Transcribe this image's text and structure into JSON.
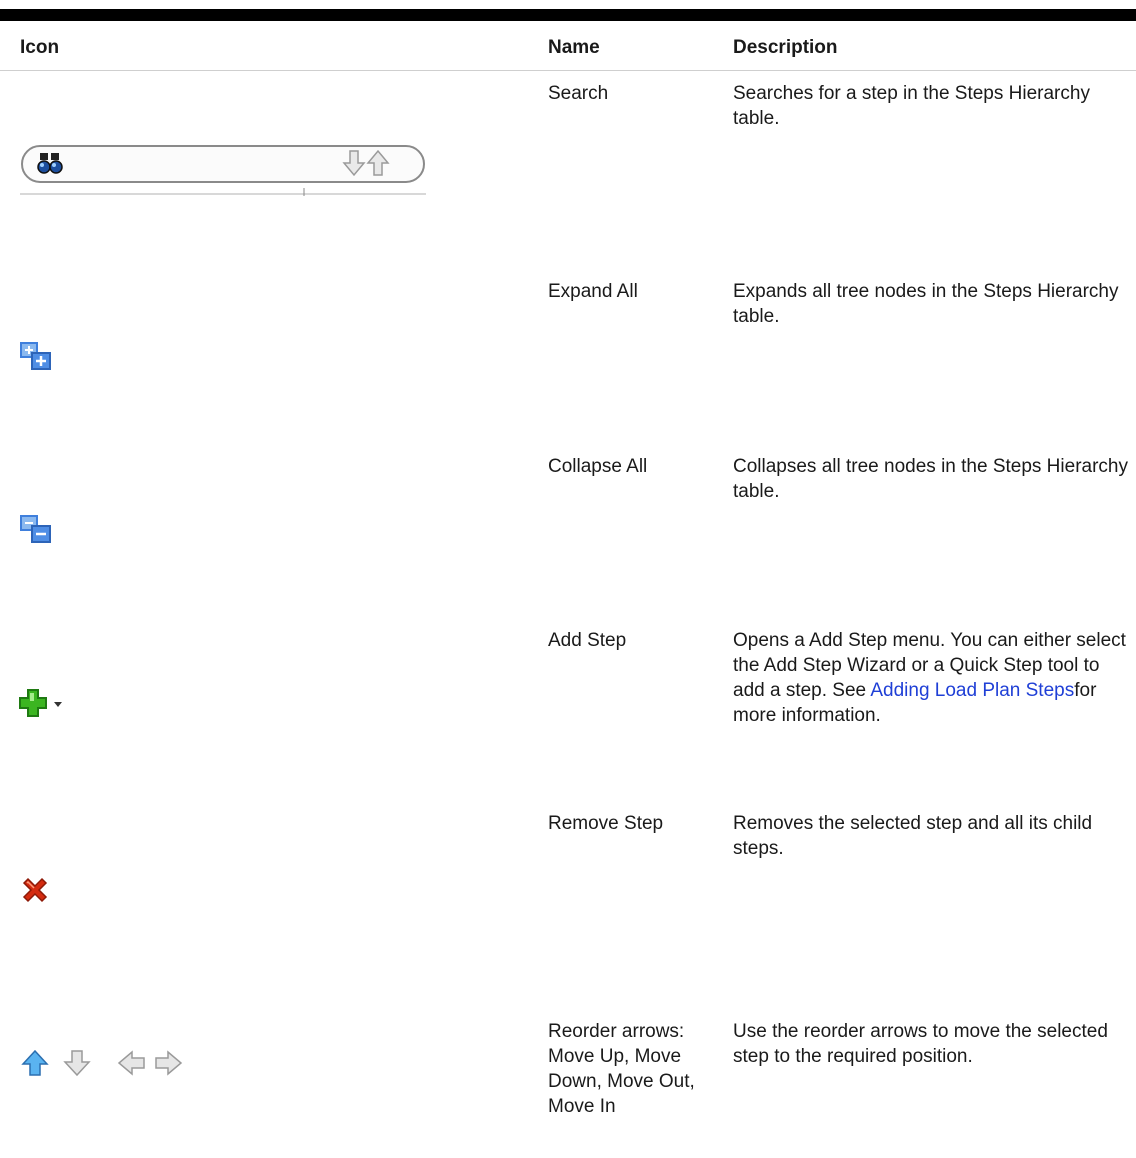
{
  "header": {
    "icon": "Icon",
    "name": "Name",
    "description": "Description"
  },
  "rows": [
    {
      "icon": "search-field-icon",
      "name": "Search",
      "description": "Searches for a step in the Steps Hierarchy table."
    },
    {
      "icon": "expand-all-icon",
      "name": "Expand All",
      "description": "Expands all tree nodes in the Steps Hierarchy table."
    },
    {
      "icon": "collapse-all-icon",
      "name": "Collapse All",
      "description": "Collapses all tree nodes in the Steps Hierarchy table."
    },
    {
      "icon": "add-step-icon",
      "name": "Add Step",
      "description_pre": "Opens a Add Step menu. You can either select the Add Step Wizard or a Quick Step tool to add a step. See ",
      "description_link": "Adding Load Plan Steps",
      "description_post": "for more information."
    },
    {
      "icon": "remove-step-icon",
      "name": "Remove Step",
      "description": "Removes the selected step and all its child steps."
    },
    {
      "icon": "reorder-arrows-icon",
      "name": "Reorder arrows: Move Up, Move Down, Move Out, Move In",
      "description": "Use the reorder arrows to move the selected step to the required position."
    }
  ],
  "colors": {
    "link": "#1f3fd6",
    "add_green": "#3cb521",
    "remove_red": "#d42b10",
    "expand_blue": "#3f7fdc"
  }
}
